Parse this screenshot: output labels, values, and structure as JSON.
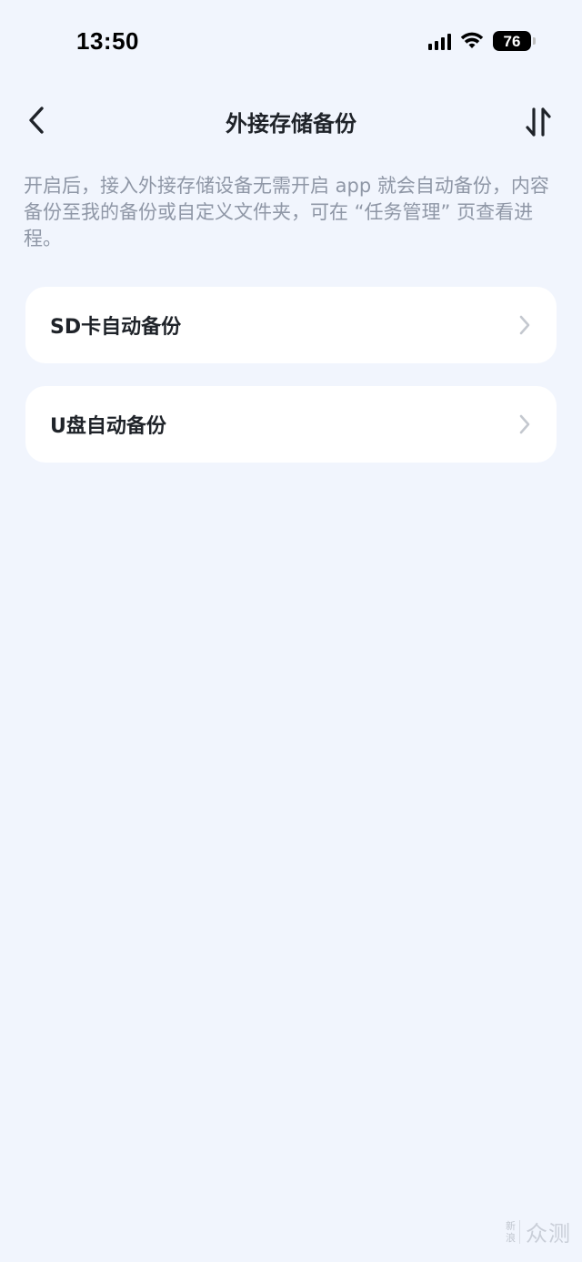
{
  "status_bar": {
    "time": "13:50",
    "battery_level": "76",
    "icons": [
      "cellular-signal-icon",
      "wifi-icon",
      "battery-icon"
    ]
  },
  "nav": {
    "title": "外接存储备份",
    "back_icon": "chevron-left-icon",
    "sort_icon": "transfer-arrows-icon"
  },
  "description": "开启后，接入外接存储设备无需开启 app 就会自动备份，内容备份至我的备份或自定义文件夹，可在 “任务管理” 页查看进程。",
  "options": [
    {
      "label": "SD卡自动备份",
      "icon": "chevron-right-icon"
    },
    {
      "label": "U盘自动备份",
      "icon": "chevron-right-icon"
    }
  ],
  "watermark": {
    "small_top": "新",
    "small_bottom": "浪",
    "text": "众测"
  },
  "colors": {
    "background": "#f1f5fd",
    "card": "#ffffff",
    "title_text": "#1f2329",
    "description_text": "#8f97a6",
    "chevron": "#c4c8cf"
  }
}
